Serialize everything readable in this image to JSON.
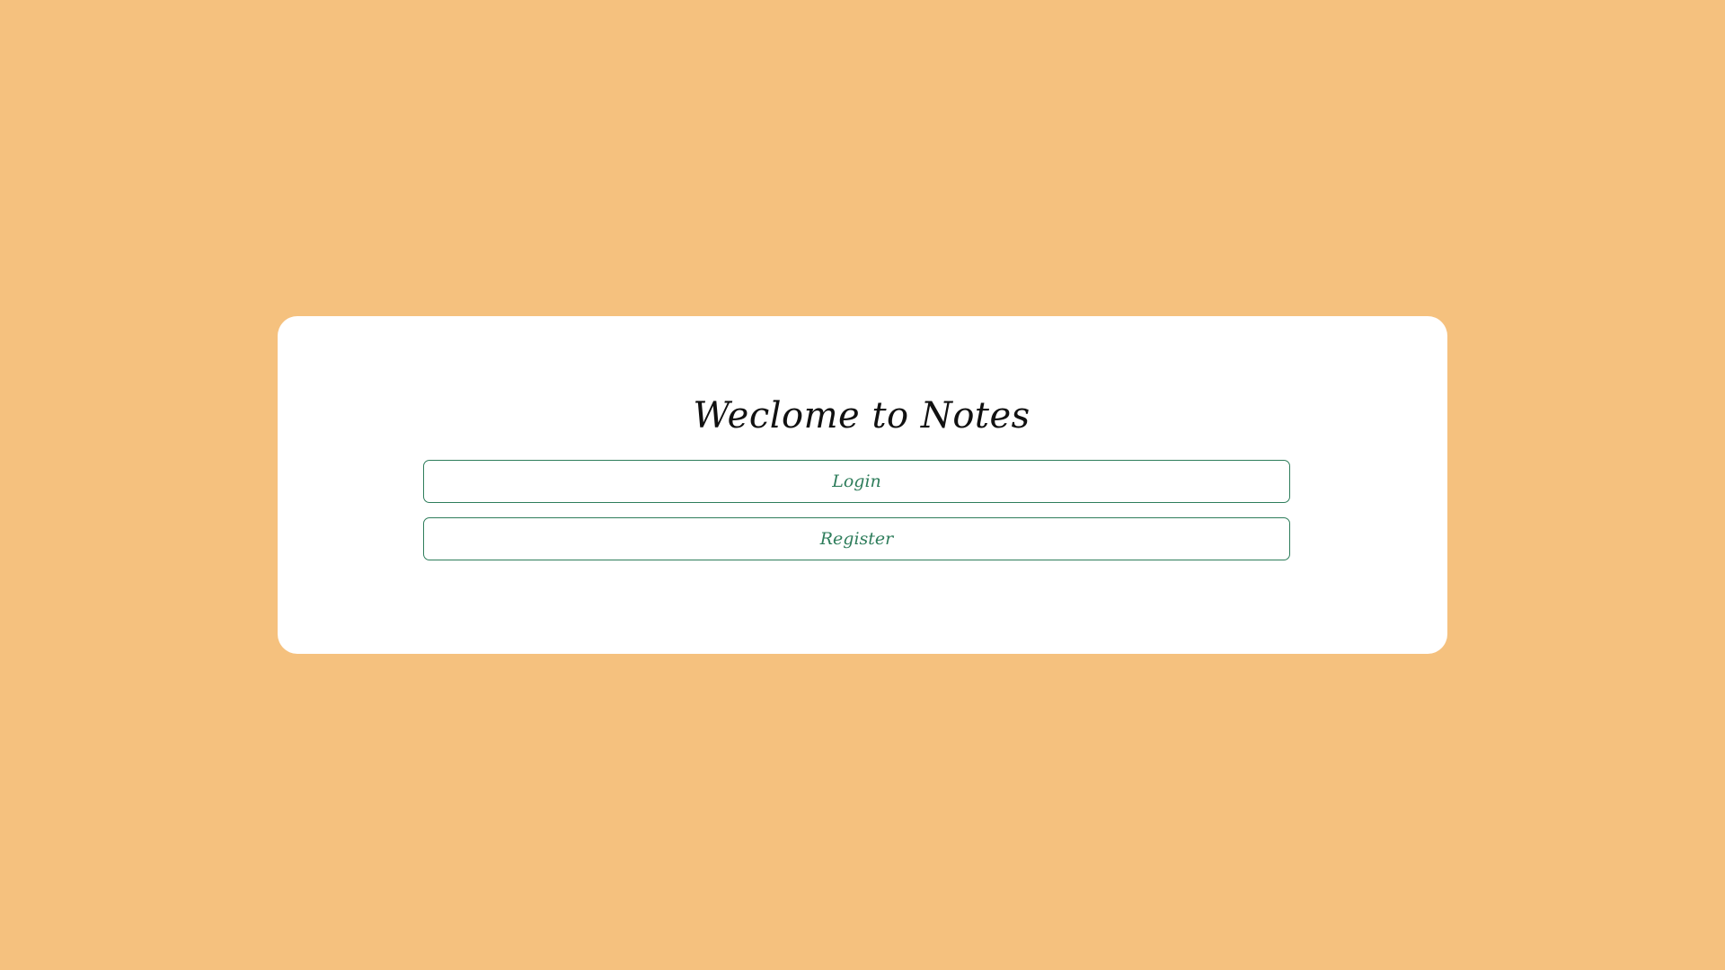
{
  "colors": {
    "background": "#f5c17e",
    "card": "#ffffff",
    "accent": "#2e7d5b",
    "title": "#111111"
  },
  "welcome": {
    "title": "Weclome to Notes",
    "login_label": "Login",
    "register_label": "Register"
  }
}
